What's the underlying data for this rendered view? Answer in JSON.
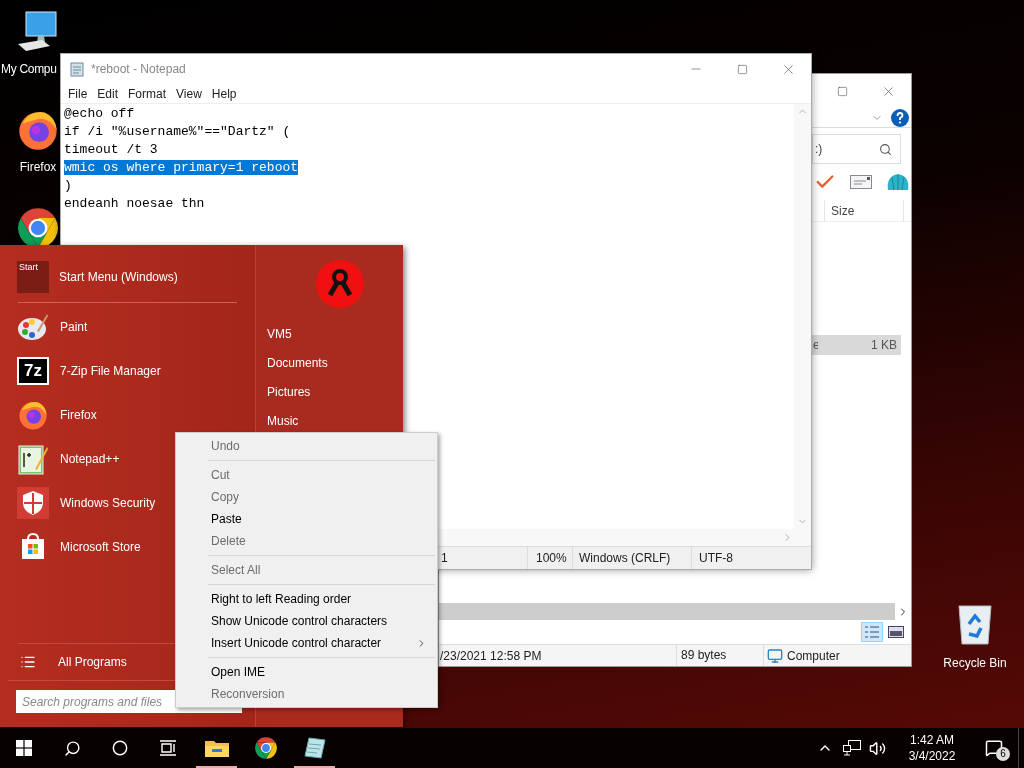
{
  "desktop_icons": [
    {
      "kind": "computer",
      "label": "My Compu"
    },
    {
      "kind": "firefox",
      "label": "Firefox"
    },
    {
      "kind": "chrome"
    }
  ],
  "recycle_bin": {
    "label": "Recycle Bin"
  },
  "explorer": {
    "search_text": ":)",
    "columns": [
      "Size"
    ],
    "file_row": {
      "name": "e",
      "size": "1 KB",
      "selected": true
    },
    "view_buttons": [
      {
        "kind": "details",
        "selected": true
      },
      {
        "kind": "preview",
        "selected": false
      }
    ],
    "status": {
      "modified": "/23/2021 12:58 PM",
      "size": "89 bytes",
      "location": "Computer"
    }
  },
  "notepad": {
    "title": "*reboot - Notepad",
    "menu": [
      "File",
      "Edit",
      "Format",
      "View",
      "Help"
    ],
    "lines": [
      {
        "text": "@echo off",
        "selected": false
      },
      {
        "text": "if /i \"%username%\"==\"Dartz\" (",
        "selected": false
      },
      {
        "text": "timeout /t 3",
        "selected": false
      },
      {
        "text": "wmic os where primary=1 reboot",
        "selected": true
      },
      {
        "text": ")",
        "selected": false
      },
      {
        "text": "endeanh noesae thn",
        "selected": false
      }
    ],
    "status": [
      "1",
      "100%",
      "Windows (CRLF)",
      "UTF-8"
    ]
  },
  "start_menu": {
    "header": {
      "logo_text": "Start",
      "label": "Start Menu (Windows)"
    },
    "programs": [
      {
        "kind": "paint",
        "label": "Paint"
      },
      {
        "kind": "sevenzip",
        "label": "7-Zip File Manager",
        "icon_text": "7z"
      },
      {
        "kind": "firefox",
        "label": "Firefox"
      },
      {
        "kind": "notepadpp",
        "label": "Notepad++"
      },
      {
        "kind": "security",
        "label": "Windows Security"
      },
      {
        "kind": "store",
        "label": "Microsoft Store"
      }
    ],
    "places": [
      "VM5",
      "Documents",
      "Pictures",
      "Music"
    ],
    "all_programs": "All Programs",
    "search": {
      "placeholder": "Search programs and files"
    }
  },
  "context_menu": {
    "items": [
      {
        "kind": "item",
        "label": "Undo",
        "disabled": true,
        "submenu": false
      },
      {
        "kind": "separator"
      },
      {
        "kind": "item",
        "label": "Cut",
        "disabled": true,
        "submenu": false
      },
      {
        "kind": "item",
        "label": "Copy",
        "disabled": true,
        "submenu": false
      },
      {
        "kind": "item",
        "label": "Paste",
        "disabled": false,
        "submenu": false
      },
      {
        "kind": "item",
        "label": "Delete",
        "disabled": true,
        "submenu": false
      },
      {
        "kind": "separator"
      },
      {
        "kind": "item",
        "label": "Select All",
        "disabled": true,
        "submenu": false
      },
      {
        "kind": "separator"
      },
      {
        "kind": "item",
        "label": "Right to left Reading order",
        "disabled": false,
        "submenu": false
      },
      {
        "kind": "item",
        "label": "Show Unicode control characters",
        "disabled": false,
        "submenu": false
      },
      {
        "kind": "item",
        "label": "Insert Unicode control character",
        "disabled": false,
        "submenu": true
      },
      {
        "kind": "separator"
      },
      {
        "kind": "item",
        "label": "Open IME",
        "disabled": false,
        "submenu": false
      },
      {
        "kind": "item",
        "label": "Reconversion",
        "disabled": true,
        "submenu": false
      }
    ]
  },
  "taskbar": {
    "apps": [
      {
        "kind": "explorer",
        "running": true
      },
      {
        "kind": "chrome",
        "running": false
      },
      {
        "kind": "notepad",
        "running": true
      }
    ],
    "clock": {
      "time": "1:42 AM",
      "date": "3/4/2022"
    },
    "notifications": "6"
  }
}
